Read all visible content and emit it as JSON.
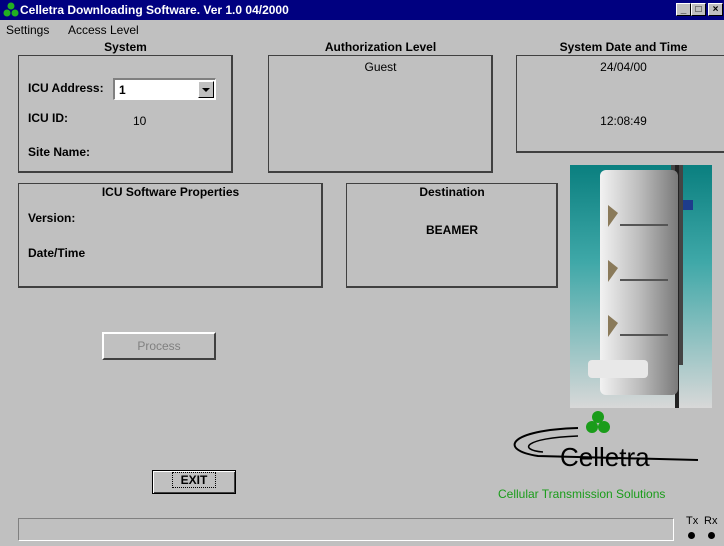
{
  "window": {
    "title": "Celletra Downloading Software. Ver 1.0   04/2000",
    "minimize_glyph": "_",
    "maximize_glyph": "□",
    "close_glyph": "×"
  },
  "menu": {
    "items": [
      "Settings",
      "Access Level"
    ]
  },
  "system": {
    "title": "System",
    "icu_address_label": "ICU Address:",
    "icu_address_value": "1",
    "icu_id_label": "ICU ID:",
    "icu_id_value": "10",
    "site_name_label": "Site Name:"
  },
  "authorization": {
    "title": "Authorization Level",
    "value": "Guest"
  },
  "datetime": {
    "title": "System Date and Time",
    "date": "24/04/00",
    "time": "12:08:49"
  },
  "software": {
    "title": "ICU Software Properties",
    "version_label": "Version:",
    "datetime_label": "Date/Time"
  },
  "destination": {
    "title": "Destination",
    "value": "BEAMER"
  },
  "buttons": {
    "process": "Process",
    "exit": "EXIT"
  },
  "logo": {
    "name": "Celletra",
    "tagline": "Cellular Transmission Solutions"
  },
  "indicators": {
    "tx": "Tx",
    "rx": "Rx"
  },
  "colors": {
    "titlebar": "#000080",
    "logo_green": "#1a9c1a",
    "disabled_text": "#808080"
  }
}
